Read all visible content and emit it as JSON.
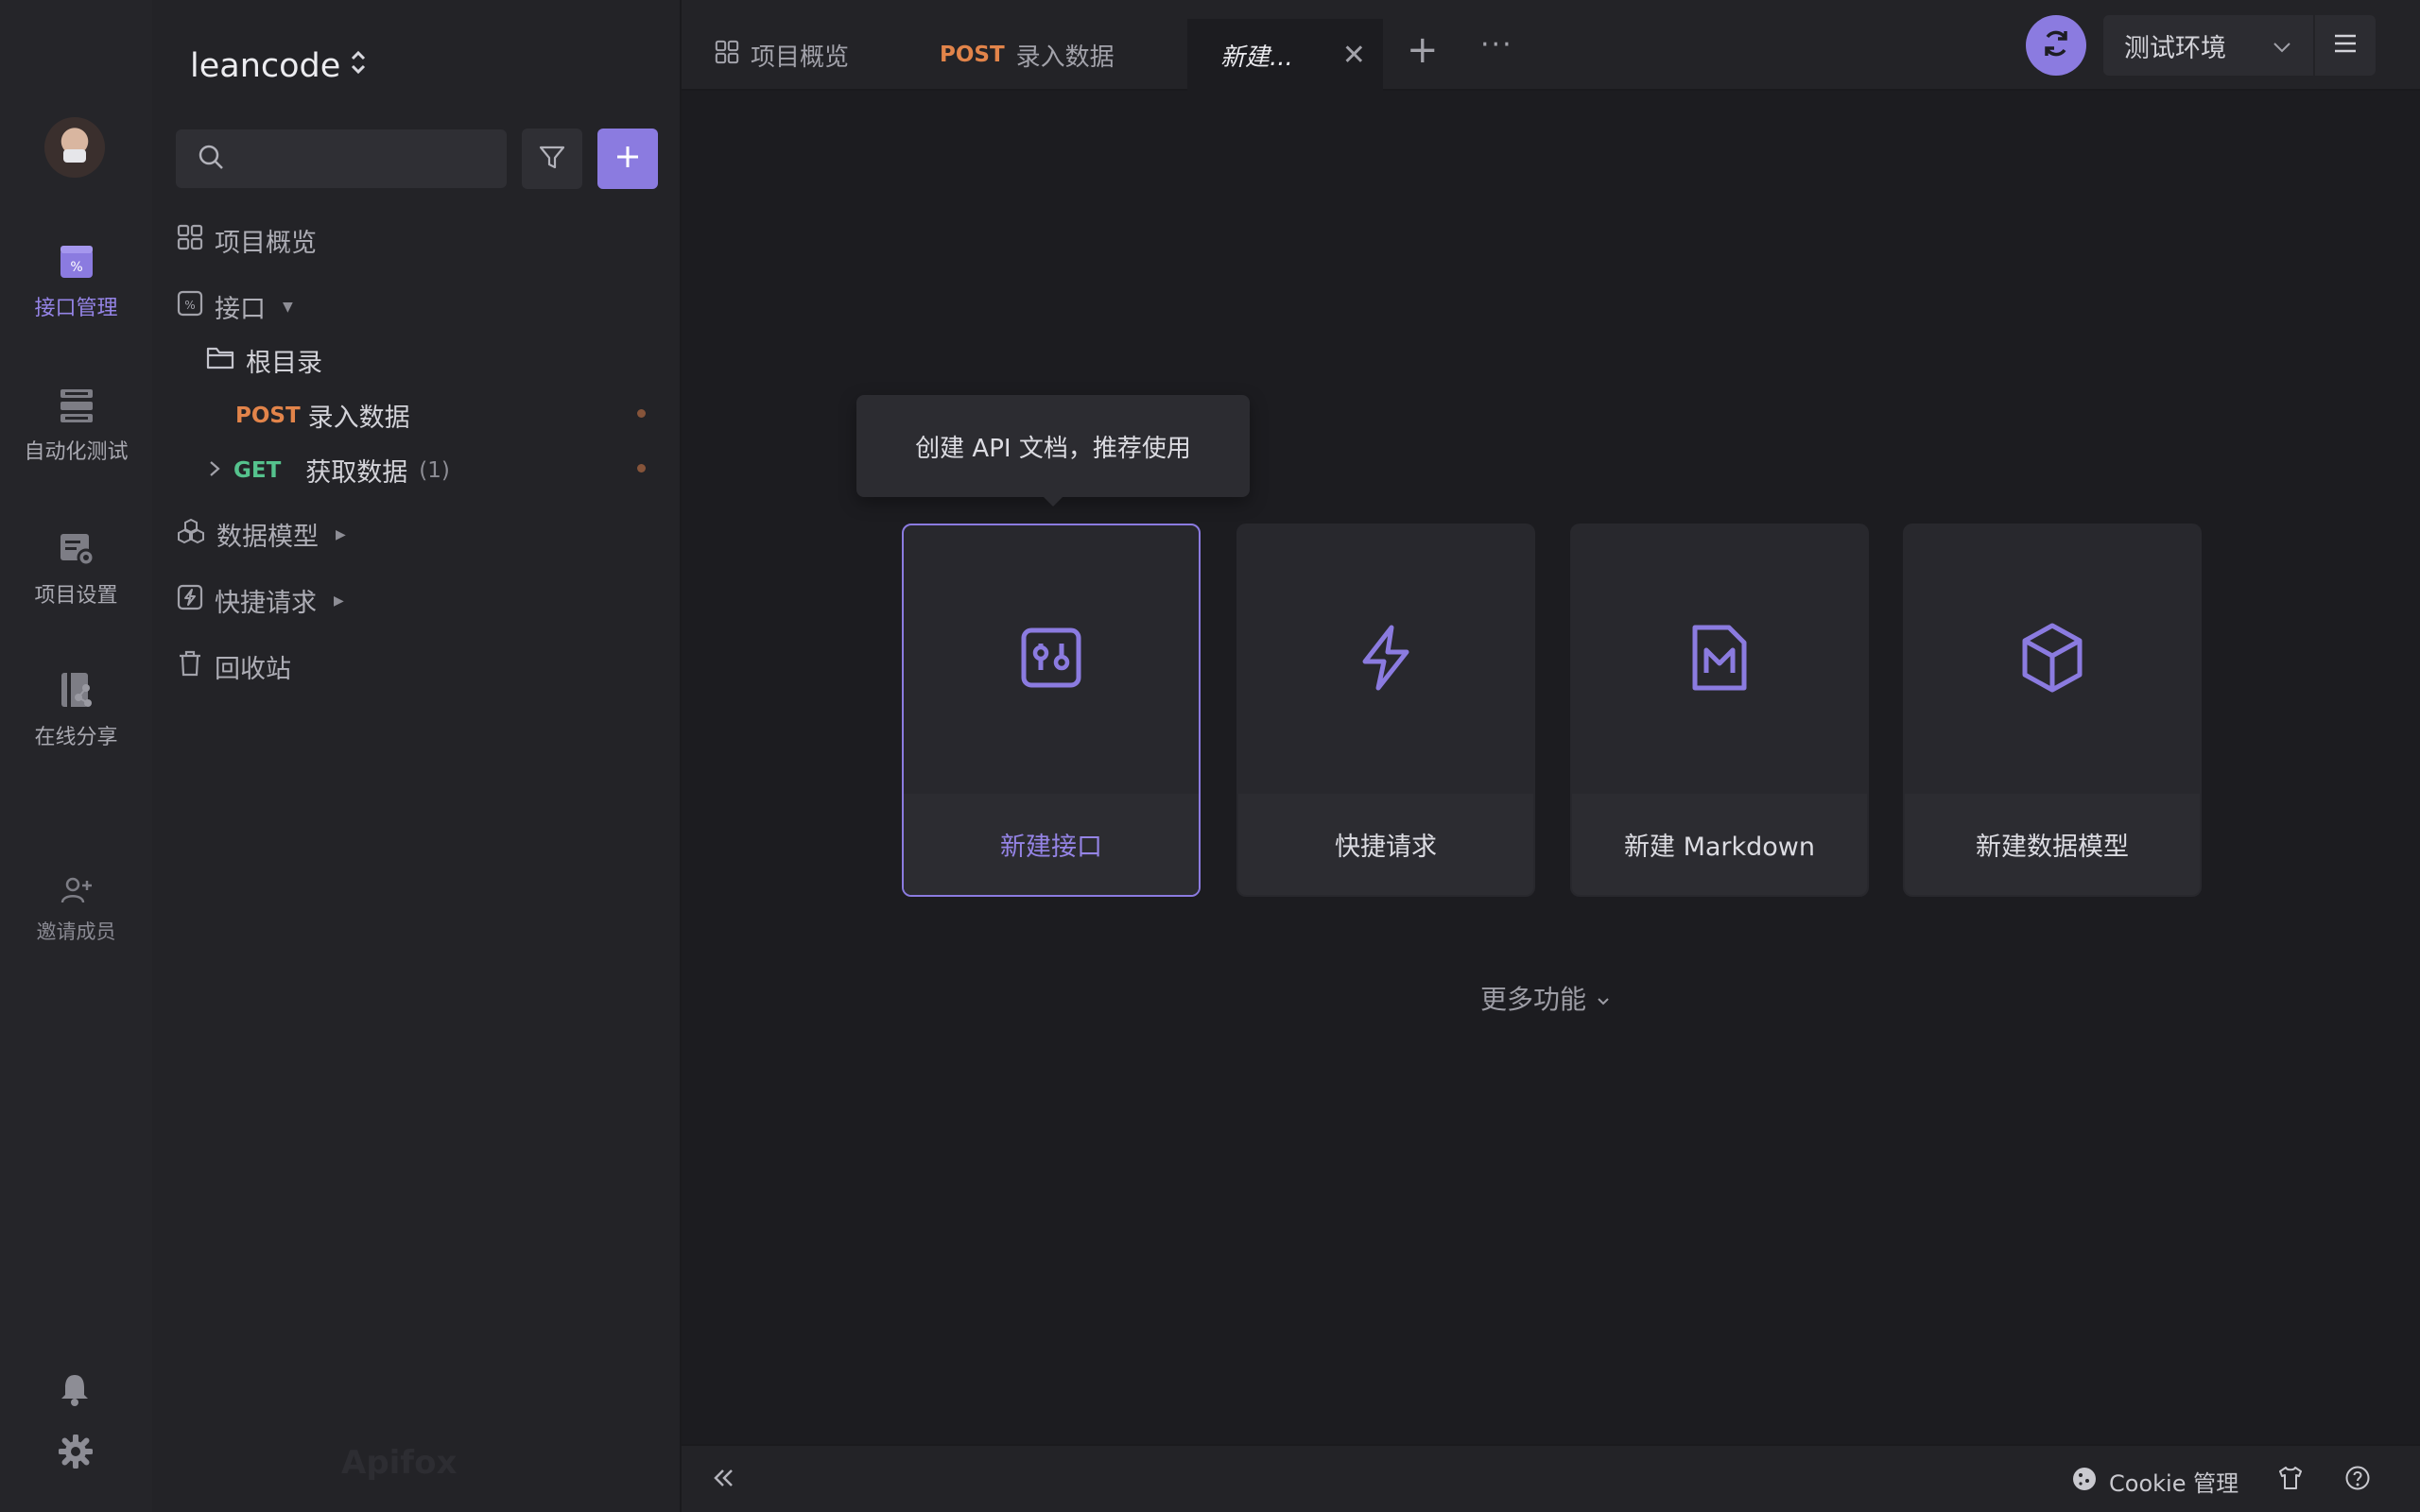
{
  "project": {
    "name": "leancode"
  },
  "rail": {
    "items": [
      {
        "label": "接口管理"
      },
      {
        "label": "自动化测试"
      },
      {
        "label": "项目设置"
      },
      {
        "label": "在线分享"
      }
    ],
    "invite_label": "邀请成员"
  },
  "sidebar": {
    "search_placeholder": "",
    "tree": {
      "overview": "项目概览",
      "interfaces": "接口",
      "root_folder": "根目录",
      "endpoints": [
        {
          "method": "POST",
          "name": "录入数据"
        },
        {
          "method": "GET",
          "name": "获取数据",
          "count": "(1)"
        }
      ],
      "data_models": "数据模型",
      "quick_requests": "快捷请求",
      "trash": "回收站"
    },
    "watermark": "Apifox"
  },
  "tabs": [
    {
      "label": "项目概览"
    },
    {
      "method": "POST",
      "label": "录入数据"
    },
    {
      "label": "新建..."
    }
  ],
  "environment": {
    "selected": "测试环境"
  },
  "main": {
    "tooltip": "创建 API 文档，推荐使用",
    "cards": [
      {
        "label": "新建接口",
        "icon": "api-doc-icon"
      },
      {
        "label": "快捷请求",
        "icon": "lightning-icon"
      },
      {
        "label": "新建 Markdown",
        "icon": "markdown-icon"
      },
      {
        "label": "新建数据模型",
        "icon": "cube-icon"
      }
    ],
    "more_label": "更多功能"
  },
  "statusbar": {
    "cookie_label": "Cookie 管理"
  },
  "colors": {
    "accent": "#8b7be0",
    "post": "#e2844a",
    "get": "#55c28d",
    "background": "#1c1c20"
  }
}
